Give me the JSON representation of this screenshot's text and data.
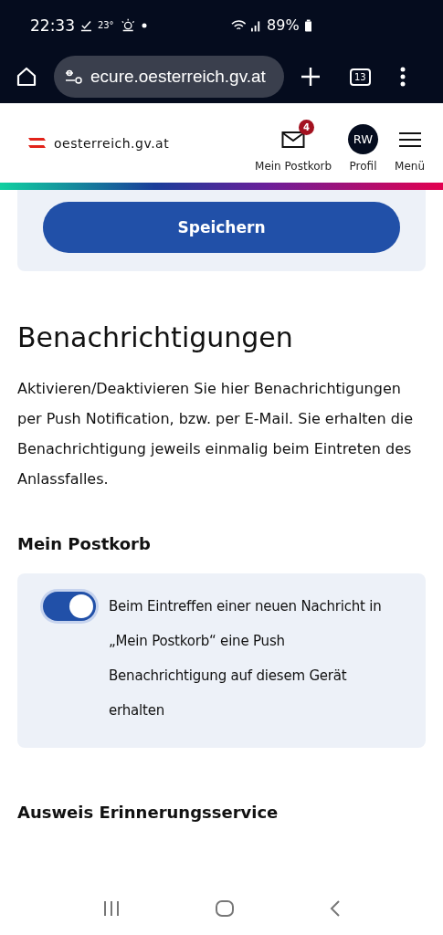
{
  "status_bar": {
    "time": "22:33",
    "temperature": "23°",
    "battery": "89%"
  },
  "browser": {
    "url": "ecure.oesterreich.gv.at",
    "tab_count": "13"
  },
  "header": {
    "logo_text": "oesterreich.gv.at",
    "items": [
      {
        "kind": "mail",
        "label": "Mein Postkorb",
        "badge": "4"
      },
      {
        "kind": "avatar",
        "label": "Profil",
        "initials": "RW"
      },
      {
        "kind": "menu",
        "label": "Menü"
      }
    ]
  },
  "save_button": "Speichern",
  "section": {
    "title": "Benachrichtigungen",
    "description": "Aktivieren/Deaktivieren Sie hier Benachrichtigungen per Push Notification, bzw. per E-Mail. Sie erhalten die Benachrichtigung jeweils einmalig beim Eintreten des Anlassfalles."
  },
  "groups": [
    {
      "title": "Mein Postkorb",
      "toggles": [
        {
          "label": "Beim Eintreffen einer neuen Nachricht in „Mein Postkorb“ eine Push Benachrichtigung auf diesem Gerät erhalten",
          "on": true
        }
      ]
    },
    {
      "title": "Ausweis Erinnerungsservice"
    }
  ]
}
